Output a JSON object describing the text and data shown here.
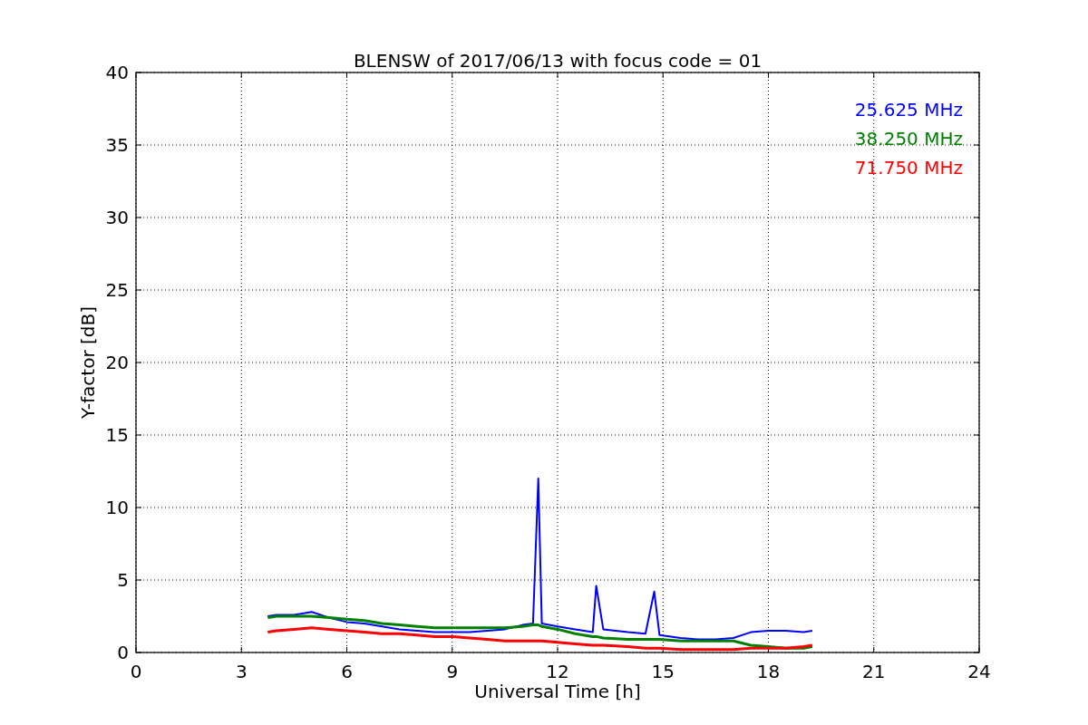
{
  "chart_data": {
    "type": "line",
    "title": "BLENSW of 2017/06/13 with focus code = 01",
    "xlabel": "Universal Time [h]",
    "ylabel": "Y-factor [dB]",
    "x": [
      3.75,
      4,
      4.5,
      5,
      5.5,
      6,
      6.5,
      7,
      7.5,
      8,
      8.5,
      9,
      9.5,
      10,
      10.5,
      11,
      11.3,
      11.45,
      11.55,
      12,
      12.5,
      13,
      13.1,
      13.3,
      14,
      14.5,
      14.75,
      14.9,
      15.5,
      16,
      16.5,
      17,
      17.5,
      18,
      18.5,
      19,
      19.25
    ],
    "series": [
      {
        "name": "25.625 MHz",
        "color": "#0000ff",
        "values": [
          2.5,
          2.6,
          2.6,
          2.8,
          2.4,
          2.1,
          2.0,
          1.8,
          1.6,
          1.5,
          1.4,
          1.4,
          1.4,
          1.5,
          1.6,
          1.9,
          2.0,
          12.0,
          2.0,
          1.8,
          1.6,
          1.4,
          4.6,
          1.6,
          1.4,
          1.3,
          4.2,
          1.2,
          1.0,
          0.9,
          0.9,
          1.0,
          1.4,
          1.5,
          1.5,
          1.4,
          1.5
        ]
      },
      {
        "name": "38.250 MHz",
        "color": "#008000",
        "values": [
          2.4,
          2.5,
          2.5,
          2.5,
          2.4,
          2.3,
          2.2,
          2.0,
          1.9,
          1.8,
          1.7,
          1.7,
          1.7,
          1.7,
          1.7,
          1.8,
          1.9,
          1.9,
          1.8,
          1.6,
          1.3,
          1.1,
          1.1,
          1.0,
          0.9,
          0.9,
          0.9,
          0.9,
          0.8,
          0.8,
          0.8,
          0.8,
          0.5,
          0.4,
          0.3,
          0.3,
          0.4
        ]
      },
      {
        "name": "71.750 MHz",
        "color": "#ff0000",
        "values": [
          1.4,
          1.5,
          1.6,
          1.7,
          1.6,
          1.5,
          1.4,
          1.3,
          1.3,
          1.2,
          1.1,
          1.1,
          1.0,
          0.9,
          0.8,
          0.8,
          0.8,
          0.8,
          0.8,
          0.7,
          0.6,
          0.5,
          0.5,
          0.5,
          0.4,
          0.3,
          0.3,
          0.3,
          0.2,
          0.2,
          0.2,
          0.2,
          0.3,
          0.3,
          0.3,
          0.4,
          0.5
        ]
      }
    ],
    "xlim": [
      0,
      24
    ],
    "ylim": [
      0,
      40
    ],
    "grid": true,
    "xticks": [
      0,
      3,
      6,
      9,
      12,
      15,
      18,
      21,
      24
    ],
    "yticks": [
      0,
      5,
      10,
      15,
      20,
      25,
      30,
      35,
      40
    ]
  }
}
